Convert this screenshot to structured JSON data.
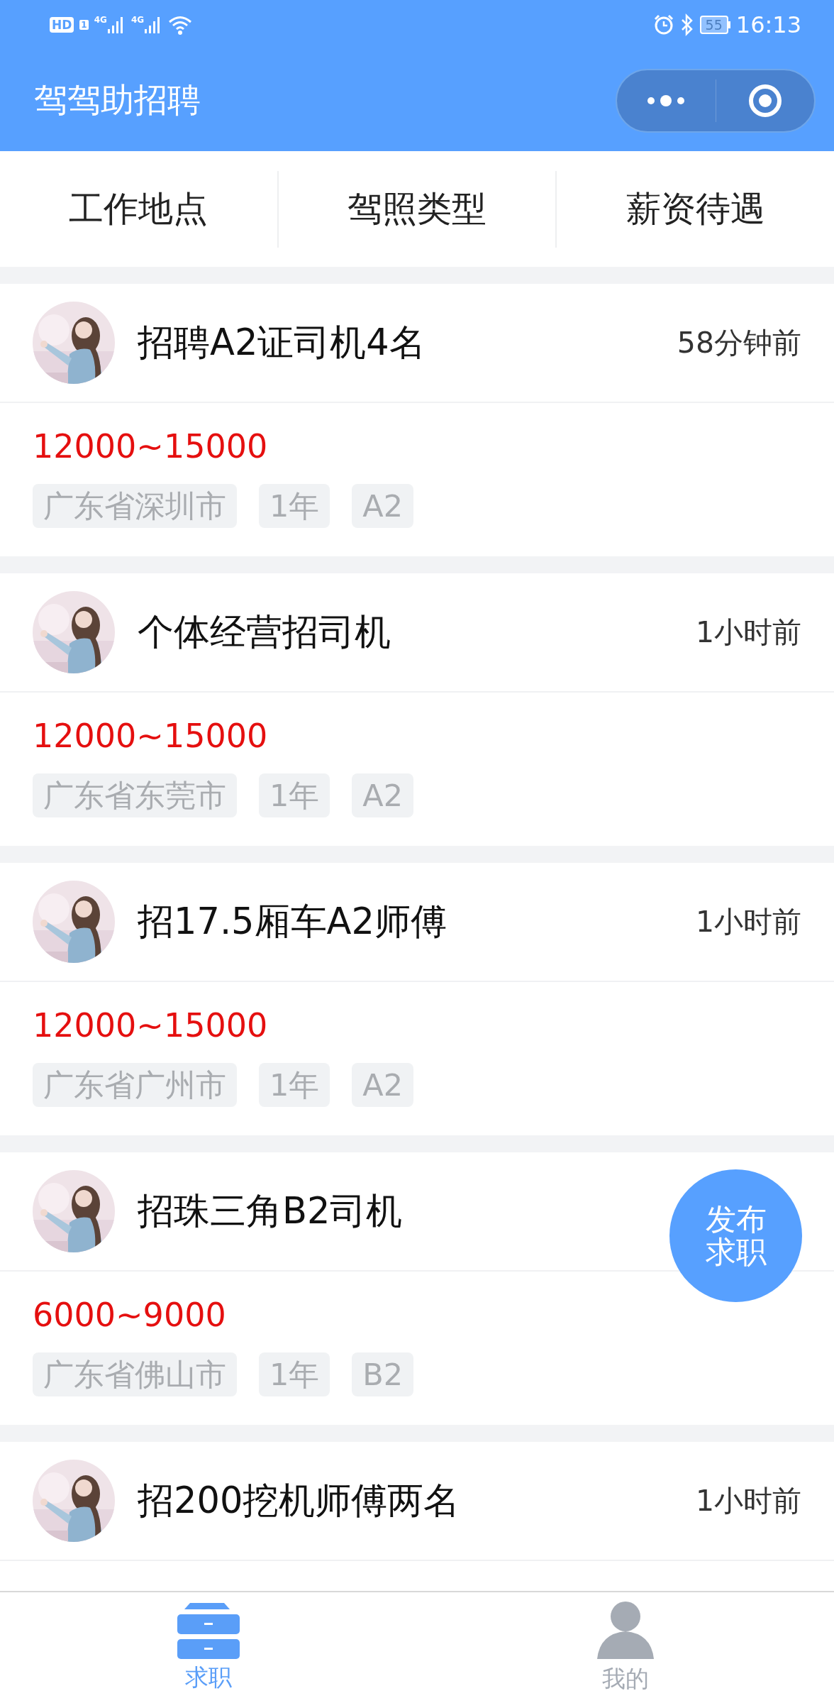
{
  "status_bar": {
    "hd": "HD",
    "sim": "1",
    "networks": [
      "4G",
      "4G"
    ],
    "battery": "55",
    "time": "16:13"
  },
  "header": {
    "title": "驾驾助招聘"
  },
  "filters": [
    "工作地点",
    "驾照类型",
    "薪资待遇"
  ],
  "jobs": [
    {
      "title": "招聘A2证司机4名",
      "time": "58分钟前",
      "salary": "12000~15000",
      "tags": [
        "广东省深圳市",
        "1年",
        "A2"
      ]
    },
    {
      "title": "个体经营招司机",
      "time": "1小时前",
      "salary": "12000~15000",
      "tags": [
        "广东省东莞市",
        "1年",
        "A2"
      ]
    },
    {
      "title": "招17.5厢车A2师傅",
      "time": "1小时前",
      "salary": "12000~15000",
      "tags": [
        "广东省广州市",
        "1年",
        "A2"
      ]
    },
    {
      "title": "招珠三角B2司机",
      "salary": "6000~9000",
      "tags": [
        "广东省佛山市",
        "1年",
        "B2"
      ]
    },
    {
      "title": "招200挖机师傅两名",
      "time": "1小时前"
    }
  ],
  "fab": {
    "label": "发布求职"
  },
  "tabs": [
    {
      "label": "求职",
      "kind": "drawer",
      "selected": true
    },
    {
      "label": "我的",
      "kind": "person",
      "selected": false
    }
  ]
}
